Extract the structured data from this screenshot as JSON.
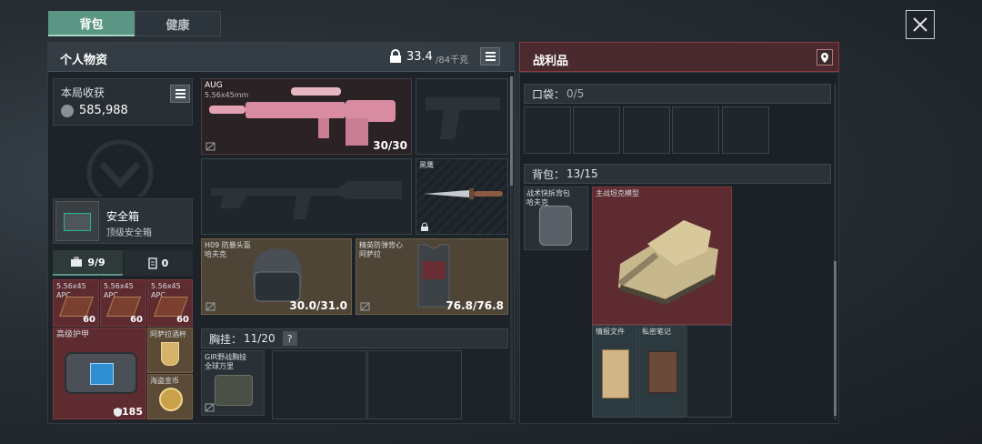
{
  "tabs": {
    "backpack": "背包",
    "health": "健康"
  },
  "left": {
    "title": "个人物资",
    "weight_current": "33.4",
    "weight_max": "/84千克",
    "income_label": "本局收获",
    "income_value": "585,988",
    "safebox_name": "安全箱",
    "safebox_sub": "顶级安全箱",
    "subtab_items": "9/9",
    "subtab_other": "0",
    "ammo": [
      {
        "name": "5.56x45",
        "sub": "APC",
        "count": "60"
      },
      {
        "name": "5.56x45",
        "sub": "APC",
        "count": "60"
      },
      {
        "name": "5.56x45",
        "sub": "APC",
        "count": "60"
      }
    ],
    "armor_label": "高级护甲",
    "armor_count": "185",
    "cup_label": "阿萨拉酒杯",
    "coin_label": "海盗金币",
    "gun_name": "AUG",
    "gun_ammo": "5.56x45mm",
    "gun_count": "30/30",
    "knife_label": "黑鹰",
    "helmet_name": "H09 防暴头盔",
    "helmet_sub": "哈夫克",
    "helmet_dur": "30.0/31.0",
    "vest_name": "精英防弹背心",
    "vest_sub": "阿萨拉",
    "vest_dur": "76.8/76.8",
    "rig_label": "胸挂：",
    "rig_count": "11/20",
    "rig_help": "?",
    "rig_item_name": "GIR野战胸挂",
    "rig_item_sub": "全球万里"
  },
  "right": {
    "title": "战利品",
    "pocket_label": "口袋：",
    "pocket_count": "0/5",
    "bag_label": "背包：",
    "bag_count": "13/15",
    "bag_item": "战术快拆背包",
    "bag_item_sub": "哈夫克",
    "tank_label": "主战坦克模型",
    "intel_label": "情报文件",
    "notes_label": "私密笔记"
  },
  "colors": {
    "accent": "#5b9583",
    "red_rarity": "#6a2c30",
    "gold_rarity": "#5a4a36"
  }
}
